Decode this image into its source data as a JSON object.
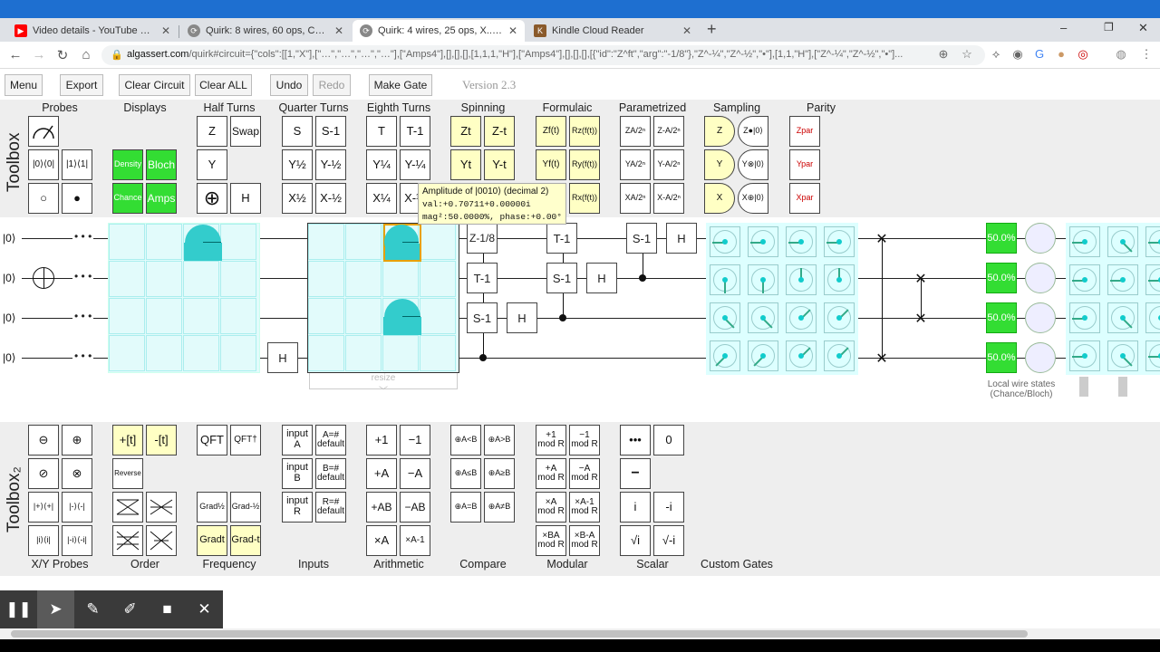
{
  "browser": {
    "tabs": [
      {
        "title": "Video details - YouTube Studio",
        "icon": "youtube-icon",
        "color": "#ff0000"
      },
      {
        "title": "Quirk: 8 wires, 60 ops, Chance...",
        "icon": "quirk-icon",
        "color": "#666666"
      },
      {
        "title": "Quirk: 4 wires, 25 ops, X...........A",
        "icon": "quirk-icon",
        "color": "#666666"
      },
      {
        "title": "Kindle Cloud Reader",
        "icon": "kindle-icon",
        "color": "#8a5a2b"
      }
    ],
    "new_tab": "+",
    "window_controls": [
      "–",
      "❐",
      "✕"
    ],
    "url_host": "algassert.com",
    "url_path": "/quirk#circuit={\"cols\":[[1,\"X\"],[\"…\",\"…\",\"…\",\"…\"],[\"Amps4\"],[],[],[],[1,1,1,\"H\"],[\"Amps4\"],[],[],[],[{\"id\":\"Z^ft\",\"arg\":\"-1/8\"},\"Z^-¼\",\"Z^-½\",\"•\"],[1,1,\"H\"],[\"Z^-¼\",\"Z^-½\",\"•\"]..."
  },
  "quirk_menu": {
    "menu": "Menu",
    "export": "Export",
    "clear_circuit": "Clear Circuit",
    "clear_all": "Clear ALL",
    "undo": "Undo",
    "redo": "Redo",
    "make_gate": "Make Gate",
    "version": "Version 2.3"
  },
  "toolbox1": {
    "title": "Toolbox",
    "groups": [
      "Probes",
      "Displays",
      "Half Turns",
      "Quarter Turns",
      "Eighth Turns",
      "Spinning",
      "Formulaic",
      "Parametrized",
      "Sampling",
      "Parity"
    ],
    "probes": [
      "|0⟩⟨0|",
      "|1⟩⟨1|",
      "○",
      "●"
    ],
    "displays": [
      "Density",
      "Bloch",
      "Chance",
      "Amps"
    ],
    "half_turns": [
      "Z",
      "Swap",
      "Y",
      "H"
    ],
    "quarter_turns": [
      "S",
      "S-1",
      "Y½",
      "Y-½",
      "X½",
      "X-½"
    ],
    "eighth_turns": [
      "T",
      "T-1",
      "Y¼",
      "Y-¼",
      "X¼",
      "X-¼"
    ],
    "spinning": [
      "Zt",
      "Z-t",
      "Yt",
      "Y-t"
    ],
    "formulaic": [
      "Zf(t)",
      "Rz(f(t))",
      "Yf(t)",
      "Ry(f(t))",
      "Rx(f(t))"
    ],
    "parametrized": [
      "ZA/2ⁿ",
      "Z-A/2ⁿ",
      "YA/2ⁿ",
      "Y-A/2ⁿ",
      "XA/2ⁿ",
      "X-A/2ⁿ"
    ],
    "sampling": [
      "Z",
      "Z●|0⟩",
      "Y",
      "Y⊗|0⟩",
      "X",
      "X⊕|0⟩"
    ],
    "parity": [
      "Zpar",
      "Ypar",
      "Xpar"
    ]
  },
  "tooltip": {
    "title": "Amplitude of |0010⟩ (decimal 2)",
    "val": "val:+0.70711+0.00000i",
    "mag": "mag²:50.0000%, phase:+0.00°"
  },
  "circuit": {
    "wire_labels": [
      "|0⟩",
      "|0⟩",
      "|0⟩",
      "|0⟩"
    ],
    "ellipsis": "• • •",
    "gates": {
      "h": "H",
      "z18": "Z-1/8",
      "t1": "T-1",
      "s1": "S-1"
    },
    "percent": [
      "50.0%",
      "50.0%",
      "50.0%",
      "50.0%"
    ],
    "resize_label": "resize",
    "local_wire_states": "Local wire states (Chance/Bloch)"
  },
  "toolbox2": {
    "title": "Toolbox₂",
    "groups": [
      "X/Y Probes",
      "Order",
      "Frequency",
      "Inputs",
      "Arithmetic",
      "Compare",
      "Modular",
      "Scalar",
      "Custom Gates"
    ],
    "xy_probes": [
      "⊖",
      "⊕",
      "⊘",
      "⊗",
      "|+⟩⟨+|",
      "|-⟩⟨-|",
      "|i⟩⟨i|",
      "|-i⟩⟨-i|"
    ],
    "order": [
      "Reverse"
    ],
    "frequency": [
      "+[t]",
      "-[t]",
      "QFT",
      "QFT†",
      "Grad½",
      "Grad-½",
      "Gradt",
      "Grad-t"
    ],
    "inputs": [
      "input A",
      "A=# default",
      "input B",
      "B=# default",
      "input R",
      "R=# default"
    ],
    "arithmetic": [
      "+1",
      "−1",
      "+A",
      "−A",
      "+AB",
      "−AB",
      "×A",
      "×A-1"
    ],
    "compare": [
      "⊕A<B",
      "⊕A>B",
      "⊕A≤B",
      "⊕A≥B",
      "⊕A=B",
      "⊕A≠B"
    ],
    "modular": [
      "+1 mod R",
      "−1 mod R",
      "+A mod R",
      "−A mod R",
      "×A mod R",
      "×A-1 mod R",
      "×BA mod R",
      "×B-A mod R"
    ],
    "scalar": [
      "•••",
      "0",
      "−",
      "i",
      "-i",
      "√i",
      "√-i"
    ]
  },
  "recorder": {
    "icons": [
      "pause-icon",
      "pointer-icon",
      "pen-icon",
      "highlighter-icon",
      "camera-icon",
      "close-icon"
    ]
  }
}
